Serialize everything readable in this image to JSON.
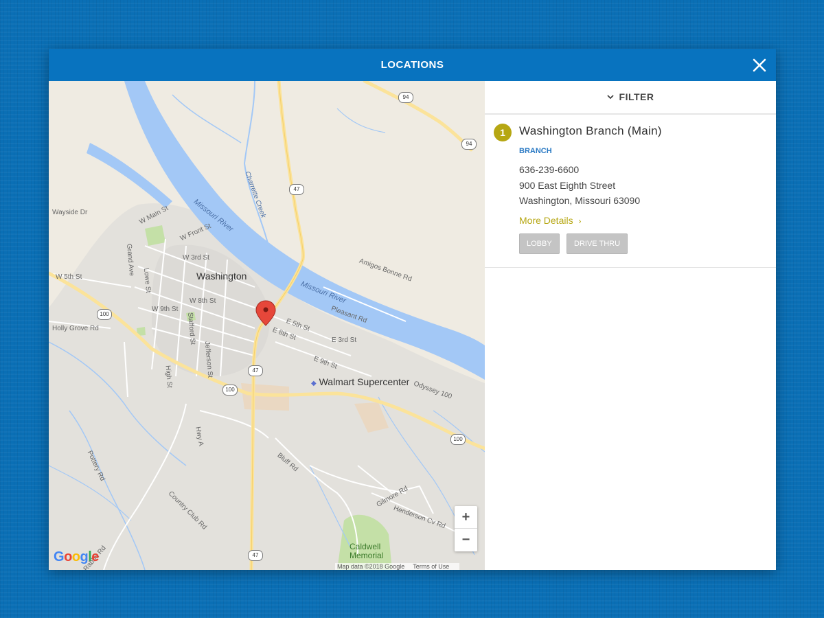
{
  "modal": {
    "title": "LOCATIONS",
    "close_icon": "close-icon"
  },
  "filter": {
    "label": "FILTER",
    "icon": "chevron-down-icon"
  },
  "locations": [
    {
      "number": "1",
      "name": "Washington Branch (Main)",
      "type": "BRANCH",
      "phone": "636-239-6600",
      "address_line1": "900 East Eighth Street",
      "address_line2": "Washington, Missouri 63090",
      "more_details": "More Details",
      "services": [
        "LOBBY",
        "DRIVE THRU"
      ]
    }
  ],
  "map": {
    "labels": {
      "city": "Washington",
      "store": "Walmart Supercenter",
      "park_line1": "Caldwell",
      "park_line2": "Memorial",
      "river1": "Missouri River",
      "river2": "Missouri River",
      "creek": "Charrette Creek",
      "streets": [
        "W Main St",
        "W Front St",
        "W 3rd St",
        "W 5th St",
        "W 9th St",
        "W 8th St",
        "E 5th St",
        "E 8th St",
        "E 3rd St",
        "E 9th St",
        "Stafford St",
        "Jefferson St",
        "High St",
        "Grand Ave",
        "Lowe St",
        "Hwy A",
        "Country Club Rd",
        "Bluff Rd",
        "Odyssey 100",
        "Rabbit Rd",
        "Wayside Dr",
        "Holly Grove Rd",
        "Pottery Rd",
        "Gilmore Rd",
        "Amigos Bonne Rd",
        "Henderson Cv Rd",
        "Pleasant Rd"
      ],
      "routes": [
        "94",
        "94",
        "47",
        "47",
        "47",
        "100",
        "100",
        "100"
      ]
    },
    "zoom_in": "+",
    "zoom_out": "−",
    "logo": "Google",
    "attribution": "Map data ©2018 Google",
    "terms": "Terms of Use",
    "colors": {
      "water": "#a3c8f6",
      "land": "#efebe2",
      "road": "#fbe39a",
      "park": "#c4e0a7",
      "marker": "#e6473a"
    }
  }
}
